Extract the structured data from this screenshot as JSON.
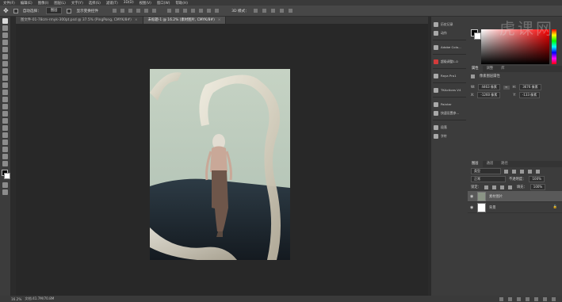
{
  "menu": [
    "文件(F)",
    "编辑(E)",
    "图像(I)",
    "图层(L)",
    "文字(Y)",
    "选择(S)",
    "滤镜(T)",
    "3D(D)",
    "视图(V)",
    "窗口(W)",
    "帮助(H)"
  ],
  "options": {
    "auto_select_label": "自动选择：",
    "auto_select_value": "图层",
    "show_transform_label": "显示变换控件",
    "mode_label": "3D 模式："
  },
  "doc_tabs": [
    "图文件-01-78cm-rmyk-300pt.psd @ 37.5% (PingPong, CMYK/8#)",
    "未标题-1 @ 16.2% (素材图片, CMYK/8#)"
  ],
  "dock": [
    {
      "icon": "history-icon",
      "label": "历史记录"
    },
    {
      "icon": "actions-icon",
      "label": "动作"
    },
    {
      "icon": "adobe-color-icon",
      "label": "Adobe Colo..."
    },
    {
      "icon": "generate-icon",
      "label": "超级调整1.0"
    },
    {
      "icon": "raya-icon",
      "label": "Raya Pro1"
    },
    {
      "icon": "tk-icon",
      "label": "TKActions V4"
    },
    {
      "icon": "pen-icon",
      "label": "Painter"
    },
    {
      "icon": "quick-mask-icon",
      "label": "快速设置参..."
    },
    {
      "icon": "paragraph-icon",
      "label": "段落"
    },
    {
      "icon": "character-icon",
      "label": "字符"
    }
  ],
  "color_panel": {
    "watermark": "虎课网"
  },
  "properties": {
    "tabs": [
      "属性",
      "调整",
      "库"
    ],
    "title": "像素图层属性",
    "w_label": "W:",
    "w_value": "4463 像素",
    "h_label": "H:",
    "h_value": "3676 像素",
    "x_label": "X:",
    "x_value": "-1260 像素",
    "y_label": "Y:",
    "y_value": "-133 像素"
  },
  "layers": {
    "tabs": [
      "图层",
      "通道",
      "路径"
    ],
    "filter_label": "类型",
    "blend_mode": "正常",
    "opacity_label": "不透明度：",
    "opacity_value": "100%",
    "lock_label": "锁定：",
    "fill_label": "填充：",
    "fill_value": "100%",
    "items": [
      {
        "name": "素材图片",
        "selected": true
      },
      {
        "name": "背景",
        "selected": false,
        "locked": true
      }
    ]
  },
  "status": {
    "zoom": "16.2%",
    "doc_info": "文档:41.7M/70.8M"
  }
}
